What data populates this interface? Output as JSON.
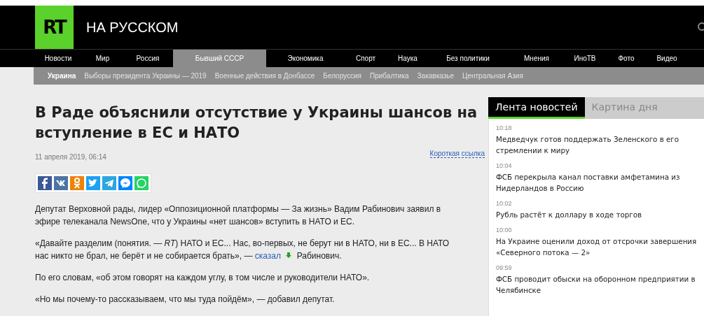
{
  "header": {
    "logo": "RT",
    "title": "НА РУССКОМ"
  },
  "nav": [
    {
      "label": "Новости",
      "selected": false
    },
    {
      "label": "Мир",
      "selected": false
    },
    {
      "label": "Россия",
      "selected": false
    },
    {
      "label": "Бывший СССР",
      "selected": true
    },
    {
      "label": "Экономика",
      "selected": false
    },
    {
      "label": "Спорт",
      "selected": false
    },
    {
      "label": "Наука",
      "selected": false
    },
    {
      "label": "Без политики",
      "selected": false
    },
    {
      "label": "Мнения",
      "selected": false
    },
    {
      "label": "ИноТВ",
      "selected": false
    },
    {
      "label": "Фото",
      "selected": false
    },
    {
      "label": "Видео",
      "selected": false
    }
  ],
  "subnav": [
    {
      "label": "Украина",
      "selected": true
    },
    {
      "label": "Выборы президента Украины — 2019",
      "selected": false
    },
    {
      "label": "Военные действия в Донбассе",
      "selected": false
    },
    {
      "label": "Белоруссия",
      "selected": false
    },
    {
      "label": "Прибалтика",
      "selected": false
    },
    {
      "label": "Закавказье",
      "selected": false
    },
    {
      "label": "Центральная Азия",
      "selected": false
    }
  ],
  "article": {
    "title": "В Раде объяснили отсутствие у Украины шансов на вступление в ЕС и НАТО",
    "date": "11 апреля 2019, 06:14",
    "short_link": "Короткая ссылка",
    "share": [
      {
        "kind": "facebook",
        "color": "#3b5998"
      },
      {
        "kind": "vk",
        "color": "#4c75a3"
      },
      {
        "kind": "ok",
        "color": "#ee8208"
      },
      {
        "kind": "twitter",
        "color": "#1da1f2"
      },
      {
        "kind": "telegram",
        "color": "#2ca5e0"
      },
      {
        "kind": "messenger",
        "color": "#0084ff"
      },
      {
        "kind": "whatsapp",
        "color": "#25d366"
      }
    ],
    "paragraphs": [
      {
        "text": "Депутат Верховной рады, лидер «Оппозиционной платформы — За жизнь» Вадим Рабинович заявил в эфире телеканала NewsOne, что у Украины «нет шансов» вступить в НАТО и ЕС."
      },
      {
        "text": "«Давайте разделим (понятия. — *RT*) НАТО и ЕС... Нас, во-первых, не берут ни в НАТО, ни в ЕС... В НАТО нас никто не брал, не берёт и не собирается брать», — ",
        "link": "сказал",
        "after": " Рабинович."
      },
      {
        "text": "По его словам, «об этом говорят на каждом углу, в том числе и руководители НАТО»."
      },
      {
        "text": "«Но мы почему-то рассказываем, что мы туда пойдём», — добавил депутат."
      }
    ]
  },
  "sidebar": {
    "tabs": [
      {
        "label": "Лента новостей",
        "selected": true
      },
      {
        "label": "Картина дня",
        "selected": false
      }
    ],
    "news": [
      {
        "time": "10:18",
        "title": "Медведчук готов поддержать Зеленского в его стремлении к миру"
      },
      {
        "time": "10:04",
        "title": "ФСБ перекрыла канал поставки амфетамина из Нидерландов в Россию"
      },
      {
        "time": "10:02",
        "title": "Рубль растёт к доллару в ходе торгов"
      },
      {
        "time": "10:00",
        "title": "На Украине оценили доход от отсрочки завершения «Северного потока — 2»"
      },
      {
        "time": "09:59",
        "title": "ФСБ проводит обыски на оборонном предприятии в Челябинске"
      }
    ]
  }
}
